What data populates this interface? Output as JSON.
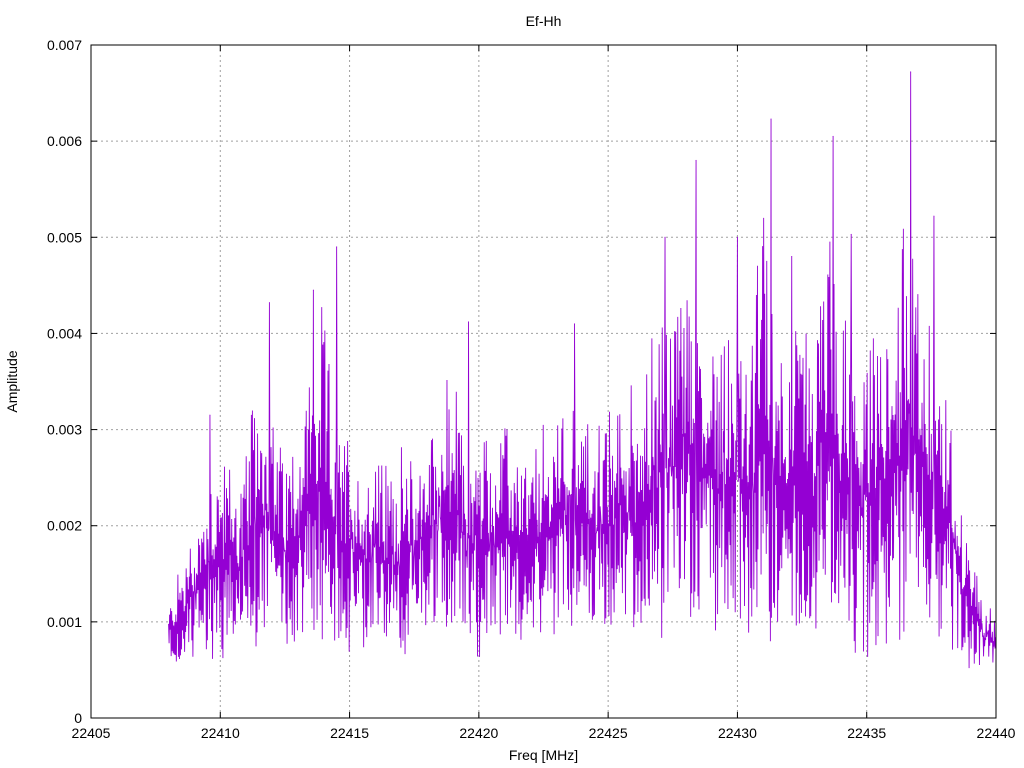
{
  "chart_data": {
    "type": "line",
    "title": "Ef-Hh",
    "xlabel": "Freq [MHz]",
    "ylabel": "Amplitude",
    "xlim": [
      22405,
      22440
    ],
    "ylim": [
      0,
      0.007
    ],
    "x_ticks": [
      "22405",
      "22410",
      "22415",
      "22420",
      "22425",
      "22430",
      "22435",
      "22440"
    ],
    "y_ticks": [
      "0",
      "0.001",
      "0.002",
      "0.003",
      "0.004",
      "0.005",
      "0.006",
      "0.007"
    ],
    "grid": true,
    "line_color": "#9400d3",
    "series": [
      {
        "x": [
          22408.0,
          22408.5,
          22409.0,
          22409.5,
          22410.0,
          22410.5,
          22411.0,
          22411.5,
          22412.0,
          22412.5,
          22413.0,
          22413.5,
          22414.0,
          22414.5,
          22415.0,
          22415.5,
          22416.0,
          22416.5,
          22417.0,
          22417.5,
          22418.0,
          22418.5,
          22419.0,
          22419.5,
          22420.0,
          22420.5,
          22421.0,
          22421.5,
          22422.0,
          22422.5,
          22423.0,
          22423.5,
          22424.0,
          22424.5,
          22425.0,
          22425.5,
          22426.0,
          22426.5,
          22427.0,
          22427.5,
          22428.0,
          22428.5,
          22429.0,
          22429.5,
          22430.0,
          22430.5,
          22431.0,
          22431.5,
          22432.0,
          22432.5,
          22433.0,
          22433.5,
          22434.0,
          22434.5,
          22435.0,
          22435.5,
          22436.0,
          22436.5,
          22437.0,
          22437.5,
          22438.0,
          22438.5,
          22439.0,
          22439.5,
          22440.0
        ],
        "envelope_low": [
          0.0005,
          0.0004,
          0.0005,
          0.0004,
          0.0002,
          0.0005,
          0.0003,
          0.0005,
          0.0006,
          0.0005,
          0.0006,
          0.0004,
          0.0005,
          0.0006,
          0.0004,
          0.0005,
          0.0006,
          0.0006,
          0.0004,
          0.0006,
          0.0007,
          0.0006,
          0.0007,
          0.0006,
          0.0003,
          0.0005,
          0.0006,
          0.0007,
          0.0007,
          0.0007,
          0.0008,
          0.0007,
          0.0006,
          0.0007,
          0.0006,
          0.0006,
          0.0005,
          0.0006,
          0.0005,
          0.0006,
          0.0005,
          0.0006,
          0.0005,
          0.0006,
          0.0005,
          0.0005,
          0.0006,
          0.0005,
          0.0006,
          0.0007,
          0.0006,
          0.0006,
          0.0005,
          0.0005,
          0.0004,
          0.0006,
          0.0005,
          0.0004,
          0.0005,
          0.0006,
          0.0005,
          0.0004,
          0.0004,
          0.0005,
          0.0004
        ],
        "envelope_high": [
          0.0013,
          0.0019,
          0.0022,
          0.003,
          0.0034,
          0.003,
          0.0032,
          0.0043,
          0.0036,
          0.0032,
          0.0036,
          0.0044,
          0.0049,
          0.0034,
          0.0036,
          0.003,
          0.0032,
          0.003,
          0.0032,
          0.0031,
          0.0034,
          0.0038,
          0.0041,
          0.0033,
          0.0036,
          0.0034,
          0.0035,
          0.0032,
          0.0031,
          0.0034,
          0.0036,
          0.0041,
          0.0036,
          0.0035,
          0.0037,
          0.0038,
          0.0041,
          0.0043,
          0.005,
          0.0048,
          0.0058,
          0.0048,
          0.0049,
          0.005,
          0.0046,
          0.0045,
          0.0062,
          0.0048,
          0.0046,
          0.0049,
          0.0045,
          0.0061,
          0.005,
          0.0044,
          0.0044,
          0.0047,
          0.0048,
          0.0067,
          0.0052,
          0.0048,
          0.004,
          0.003,
          0.0022,
          0.0013,
          0.0013
        ],
        "peaks": [
          {
            "x": 22409.6,
            "y": 0.00315
          },
          {
            "x": 22411.9,
            "y": 0.00432
          },
          {
            "x": 22413.6,
            "y": 0.00445
          },
          {
            "x": 22414.5,
            "y": 0.0049
          },
          {
            "x": 22419.6,
            "y": 0.00412
          },
          {
            "x": 22423.7,
            "y": 0.0041
          },
          {
            "x": 22427.2,
            "y": 0.005
          },
          {
            "x": 22428.4,
            "y": 0.0058
          },
          {
            "x": 22430.0,
            "y": 0.005
          },
          {
            "x": 22431.3,
            "y": 0.00623
          },
          {
            "x": 22432.1,
            "y": 0.0048
          },
          {
            "x": 22433.7,
            "y": 0.00605
          },
          {
            "x": 22434.4,
            "y": 0.00503
          },
          {
            "x": 22436.7,
            "y": 0.00672
          },
          {
            "x": 22437.6,
            "y": 0.00522
          }
        ],
        "points_count": 1600
      }
    ]
  }
}
